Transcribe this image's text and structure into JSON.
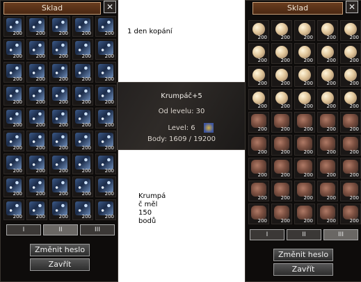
{
  "left_window": {
    "title": "Sklad",
    "close_label": "✕",
    "item_icon": "blue-crystal-icon",
    "quantities": [
      "200",
      "200",
      "200",
      "200",
      "200",
      "200",
      "200",
      "200",
      "200",
      "200",
      "200",
      "200",
      "200",
      "200",
      "200",
      "200",
      "200",
      "200",
      "200",
      "200",
      "200",
      "200",
      "200",
      "200",
      "200",
      "200",
      "200",
      "200",
      "200",
      "200",
      "200",
      "200",
      "200",
      "200",
      "200",
      "200",
      "200",
      "200",
      "200",
      "200",
      "200",
      "200",
      "200",
      "200",
      "200"
    ],
    "page_tabs": [
      "I",
      "II",
      "III"
    ],
    "active_tab": "II",
    "change_password": "Změnit heslo",
    "close_button": "Zavřít"
  },
  "right_window": {
    "title": "Sklad",
    "close_label": "✕",
    "item_icons": [
      "pearl-icon",
      "ore-stone-icon"
    ],
    "quantities": [
      "200",
      "200",
      "200",
      "200",
      "200",
      "200",
      "200",
      "200",
      "200",
      "200",
      "200",
      "200",
      "200",
      "200",
      "200",
      "200",
      "200",
      "200",
      "200",
      "200",
      "200",
      "200",
      "200",
      "200",
      "200",
      "200",
      "200",
      "200",
      "200",
      "200",
      "200",
      "200",
      "200",
      "200",
      "200",
      "200",
      "200",
      "200",
      "200",
      "200",
      "200",
      "200",
      "200",
      "200",
      "200"
    ],
    "page_tabs": [
      "I",
      "II",
      "III"
    ],
    "active_tab": "III",
    "change_password": "Změnit heslo",
    "close_button": "Zavřít"
  },
  "tooltip": {
    "title": "Krumpáč+5",
    "from_level": "Od levelu: 30",
    "level": "Level: 6",
    "points": "Body: 1609 / 19200"
  },
  "notes": {
    "top": "1 den kopání",
    "bottom": "Krumpá\nč měl\n150\nbodů"
  },
  "colors": {
    "window_bg": "#0e0c0b",
    "title_bg": "#5a321a",
    "title_border": "#c9a07a"
  }
}
